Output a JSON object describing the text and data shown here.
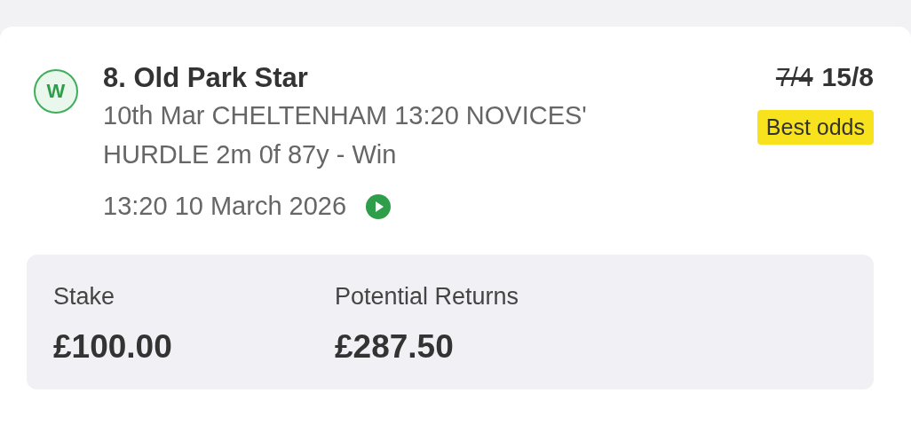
{
  "bet": {
    "result_badge": "W",
    "selection": "8. Old Park Star",
    "event": "10th Mar CHELTENHAM 13:20 NOVICES' HURDLE 2m 0f 87y - Win",
    "start_time": "13:20 10 March 2026",
    "old_odds": "7/4",
    "odds": "15/8",
    "odds_badge": "Best odds"
  },
  "summary": [
    {
      "label": "Stake",
      "value": "£100.00"
    },
    {
      "label": "Potential Returns",
      "value": "£287.50"
    }
  ]
}
